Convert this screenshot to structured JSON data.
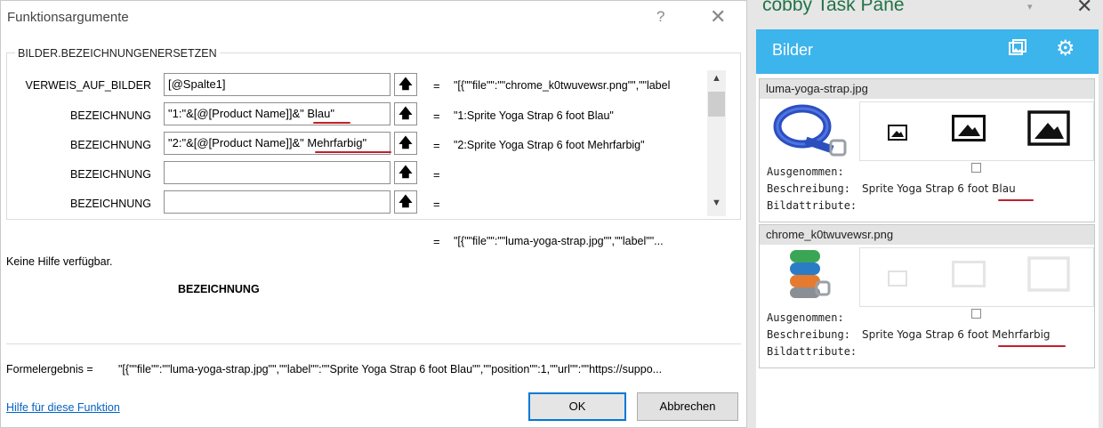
{
  "dialog": {
    "title": "Funktionsargumente",
    "help_icon": "?",
    "close_icon": "✕",
    "function_name": "BILDER.BEZEICHNUNGENERSETZEN",
    "args": [
      {
        "label": "VERWEIS_AUF_BILDER",
        "value": "[@Spalte1]",
        "eq": "=",
        "result": "\"[{\"\"file\"\":\"\"chrome_k0twuvewsr.png\"\",\"\"label"
      },
      {
        "label": "BEZEICHNUNG",
        "value": "\"1:\"&[@[Product Name]]&\" Blau\"",
        "eq": "=",
        "result": "\"1:Sprite Yoga Strap 6 foot Blau\""
      },
      {
        "label": "BEZEICHNUNG",
        "value": "\"2:\"&[@[Product Name]]&\" Mehrfarbig\"",
        "eq": "=",
        "result": "\"2:Sprite Yoga Strap 6 foot Mehrfarbig\""
      },
      {
        "label": "BEZEICHNUNG",
        "value": "",
        "eq": "=",
        "result": ""
      },
      {
        "label": "BEZEICHNUNG",
        "value": "",
        "eq": "=",
        "result": ""
      }
    ],
    "arg_button_icon": "🡅",
    "overall_eq": "=",
    "overall_result": "\"[{\"\"file\"\":\"\"luma-yoga-strap.jpg\"\",\"\"label\"\"...",
    "help_text": "Keine Hilfe verfügbar.",
    "current_arg": "BEZEICHNUNG",
    "formula_result_label": "Formelergebnis =",
    "formula_result_value": "\"[{\"\"file\"\":\"\"luma-yoga-strap.jpg\"\",\"\"label\"\":\"\"Sprite Yoga Strap 6 foot Blau\"\",\"\"position\"\":1,\"\"url\"\":\"\"https://suppo...",
    "help_link": "Hilfe für diese Funktion",
    "ok": "OK",
    "cancel": "Abbrechen"
  },
  "pane": {
    "title": "cobby Task Pane",
    "min_icon": "▾",
    "close_icon": "✕",
    "header": "Bilder",
    "cards": [
      {
        "file": "luma-yoga-strap.jpg",
        "excluded_label": "Ausgenommen:",
        "desc_label": "Beschreibung:",
        "desc_value": "Sprite Yoga Strap 6 foot Blau",
        "attr_label": "Bildattribute:"
      },
      {
        "file": "chrome_k0twuvewsr.png",
        "excluded_label": "Ausgenommen:",
        "desc_label": "Beschreibung:",
        "desc_value": "Sprite Yoga Strap 6 foot Mehrfarbig",
        "attr_label": "Bildattribute:"
      }
    ]
  },
  "colors": {
    "accent": "#3cb4ec",
    "pane_title": "#217346",
    "underline": "#c0202a",
    "link": "#0563c1"
  }
}
